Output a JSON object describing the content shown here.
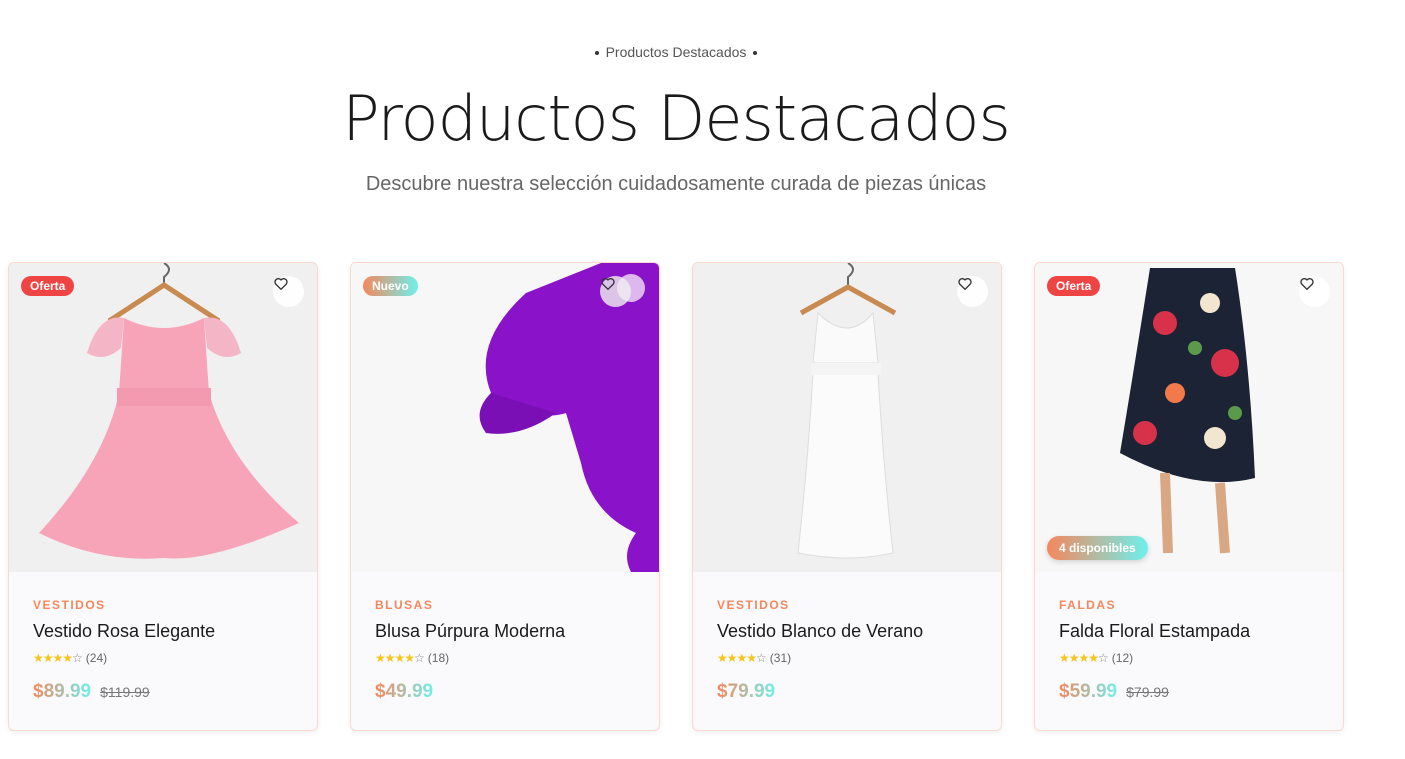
{
  "header": {
    "eyebrow": "Productos Destacados",
    "title": "Productos Destacados",
    "subtitle": "Descubre nuestra selección cuidadosamente curada de piezas únicas"
  },
  "colors": {
    "accent_start": "#f5875c",
    "accent_end": "#6ef0ec",
    "sale_badge": "#ef4444",
    "star": "#f5c518"
  },
  "products": [
    {
      "badge": "Oferta",
      "badge_type": "sale",
      "category": "VESTIDOS",
      "name": "Vestido Rosa Elegante",
      "rating": 4,
      "reviews": "(24)",
      "price": "$89.99",
      "old_price": "$119.99",
      "stock": ""
    },
    {
      "badge": "Nuevo",
      "badge_type": "new",
      "category": "BLUSAS",
      "name": "Blusa Púrpura Moderna",
      "rating": 4,
      "reviews": "(18)",
      "price": "$49.99",
      "old_price": "",
      "stock": ""
    },
    {
      "badge": "",
      "badge_type": "",
      "category": "VESTIDOS",
      "name": "Vestido Blanco de Verano",
      "rating": 4,
      "reviews": "(31)",
      "price": "$79.99",
      "old_price": "",
      "stock": ""
    },
    {
      "badge": "Oferta",
      "badge_type": "sale",
      "category": "FALDAS",
      "name": "Falda Floral Estampada",
      "rating": 4,
      "reviews": "(12)",
      "price": "$59.99",
      "old_price": "$79.99",
      "stock": "4 disponibles"
    }
  ]
}
